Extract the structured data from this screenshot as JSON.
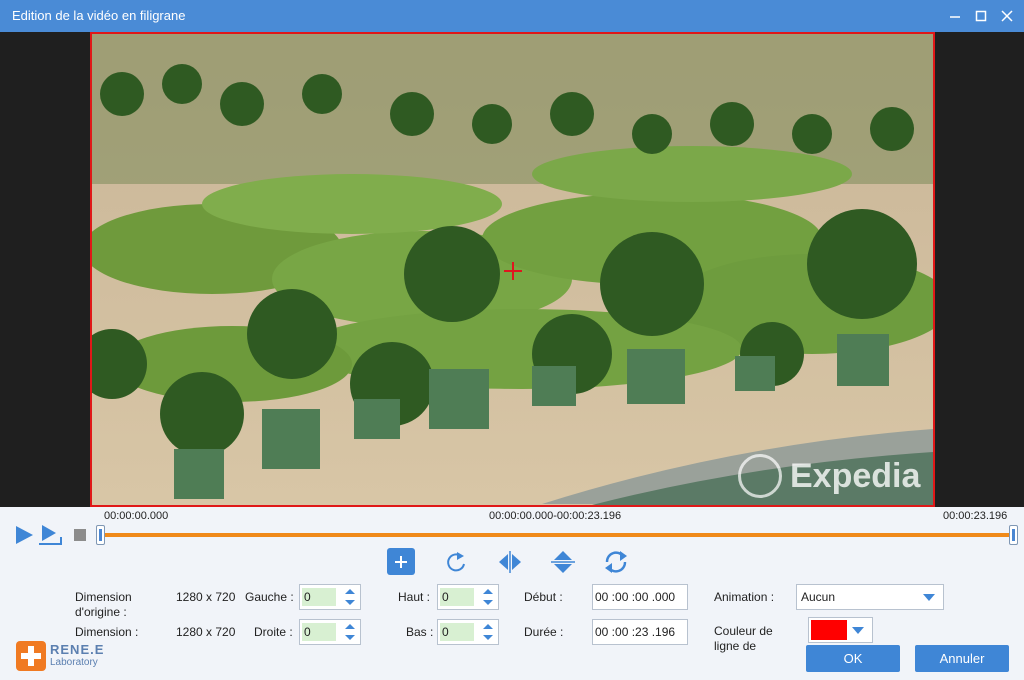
{
  "window": {
    "title": "Edition de la vidéo en filigrane",
    "controls": [
      "minimize",
      "maximize",
      "close"
    ]
  },
  "watermark": {
    "text": "Expedia"
  },
  "timeline": {
    "start": "00:00:00.000",
    "range": "00:00:00.000-00:00:23.196",
    "end": "00:00:23.196"
  },
  "playback": {
    "icons": [
      "play-icon",
      "step-play-icon",
      "stop-icon"
    ]
  },
  "tools": [
    "add-icon",
    "rotate-icon",
    "flip-horizontal-icon",
    "flip-vertical-icon",
    "refresh-icon"
  ],
  "form": {
    "orig_label": "Dimension d'origine :",
    "orig_value": "1280 x 720",
    "dim_label": "Dimension :",
    "dim_value": "1280 x 720",
    "gauche_label": "Gauche :",
    "gauche_value": "0",
    "droite_label": "Droite :",
    "droite_value": "0",
    "haut_label": "Haut :",
    "haut_value": "0",
    "bas_label": "Bas :",
    "bas_value": "0",
    "debut_label": "Début :",
    "debut_value": "00 :00 :00 .000",
    "duree_label": "Durée :",
    "duree_value": "00 :00 :23 .196",
    "animation_label": "Animation :",
    "animation_value": "Aucun",
    "couleur_label": "Couleur de ligne de",
    "couleur_value": "#ff0000"
  },
  "buttons": {
    "ok": "OK",
    "cancel": "Annuler"
  },
  "logo": {
    "brand": "RENE.E",
    "sub": "Laboratory"
  },
  "colors": {
    "titlebar": "#4a8bd6",
    "accent": "#3f86d6",
    "progress": "#f08a1a",
    "selection_border": "#e01818"
  }
}
